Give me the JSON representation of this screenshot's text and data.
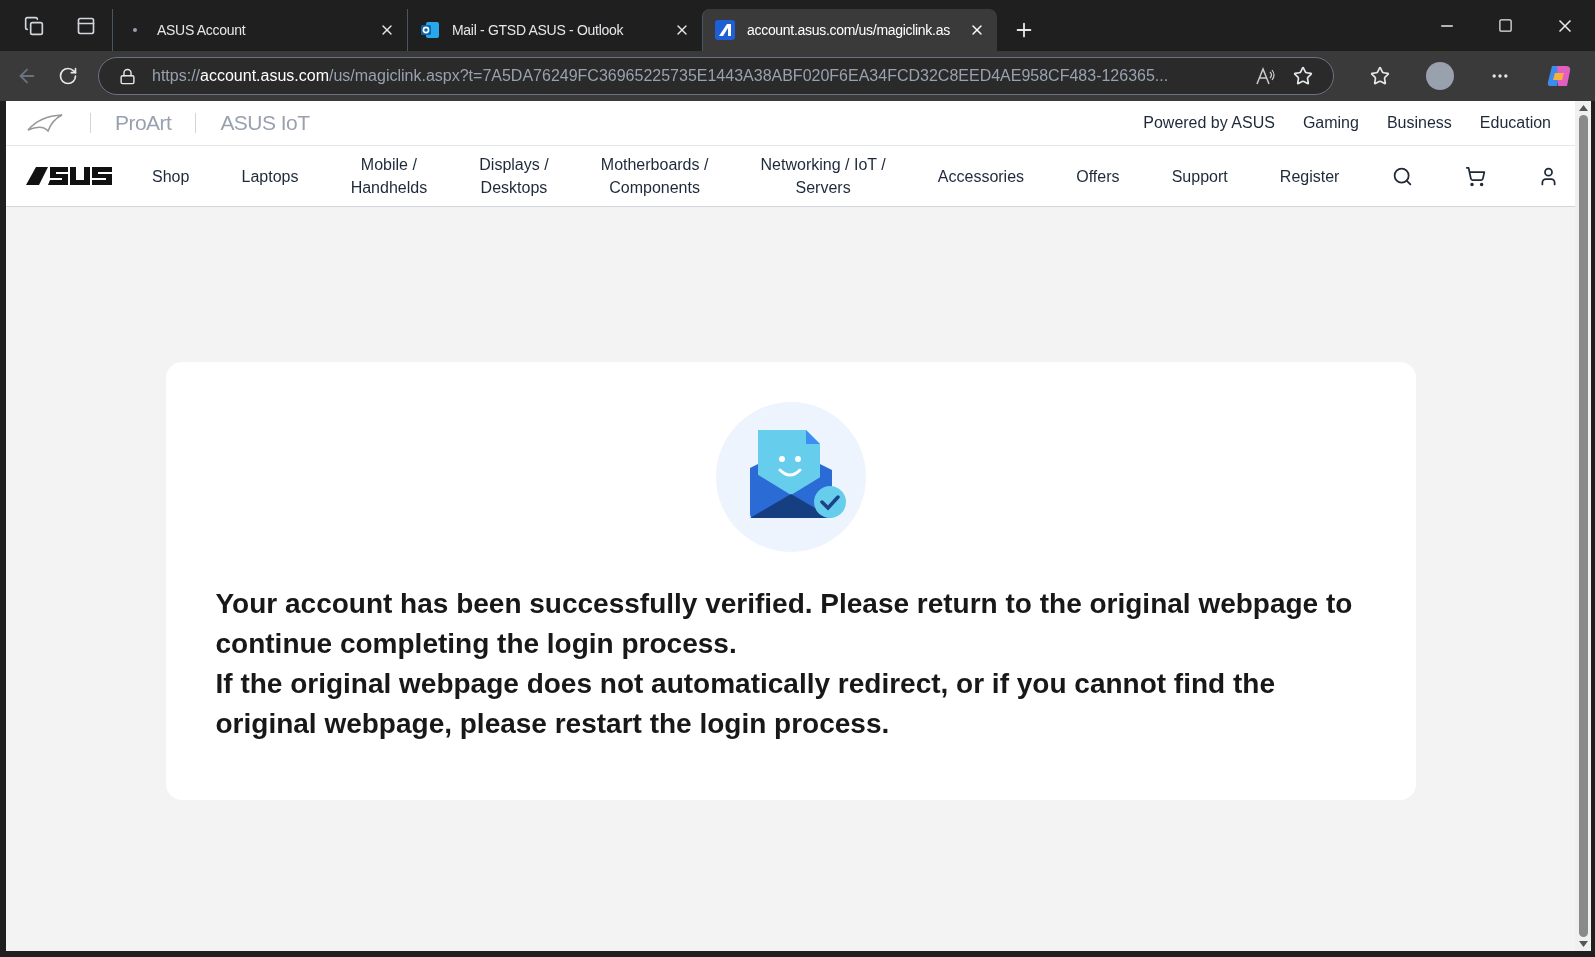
{
  "tabs": [
    {
      "title": "ASUS Account",
      "selected": false,
      "kind": "dot"
    },
    {
      "title": "Mail - GTSD ASUS - Outlook",
      "selected": false,
      "kind": "outlook"
    },
    {
      "title": "account.asus.com/us/magiclink.as",
      "selected": true,
      "kind": "asus"
    }
  ],
  "address_bar": {
    "scheme": "https://",
    "host": "account.asus.com",
    "path": "/us/magiclink.aspx?t=7A5DA76249FC36965225735E1443A38ABF020F6EA34FCD32C8EED4AE958CF483-126365..."
  },
  "brand_bar": {
    "brands": [
      "ProArt",
      "ASUS IoT"
    ],
    "links": [
      "Powered by ASUS",
      "Gaming",
      "Business",
      "Education"
    ]
  },
  "nav": {
    "items": [
      [
        "Shop"
      ],
      [
        "Laptops"
      ],
      [
        "Mobile /",
        "Handhelds"
      ],
      [
        "Displays /",
        "Desktops"
      ],
      [
        "Motherboards /",
        "Components"
      ],
      [
        "Networking / IoT /",
        "Servers"
      ],
      [
        "Accessories"
      ],
      [
        "Offers"
      ],
      [
        "Support"
      ],
      [
        "Register"
      ]
    ]
  },
  "message": {
    "paragraphs": [
      "Your account has been successfully verified. Please return to the original webpage to continue completing the login process.",
      "If the original webpage does not automatically redirect, or if you cannot find the original webpage, please restart the login process."
    ]
  }
}
